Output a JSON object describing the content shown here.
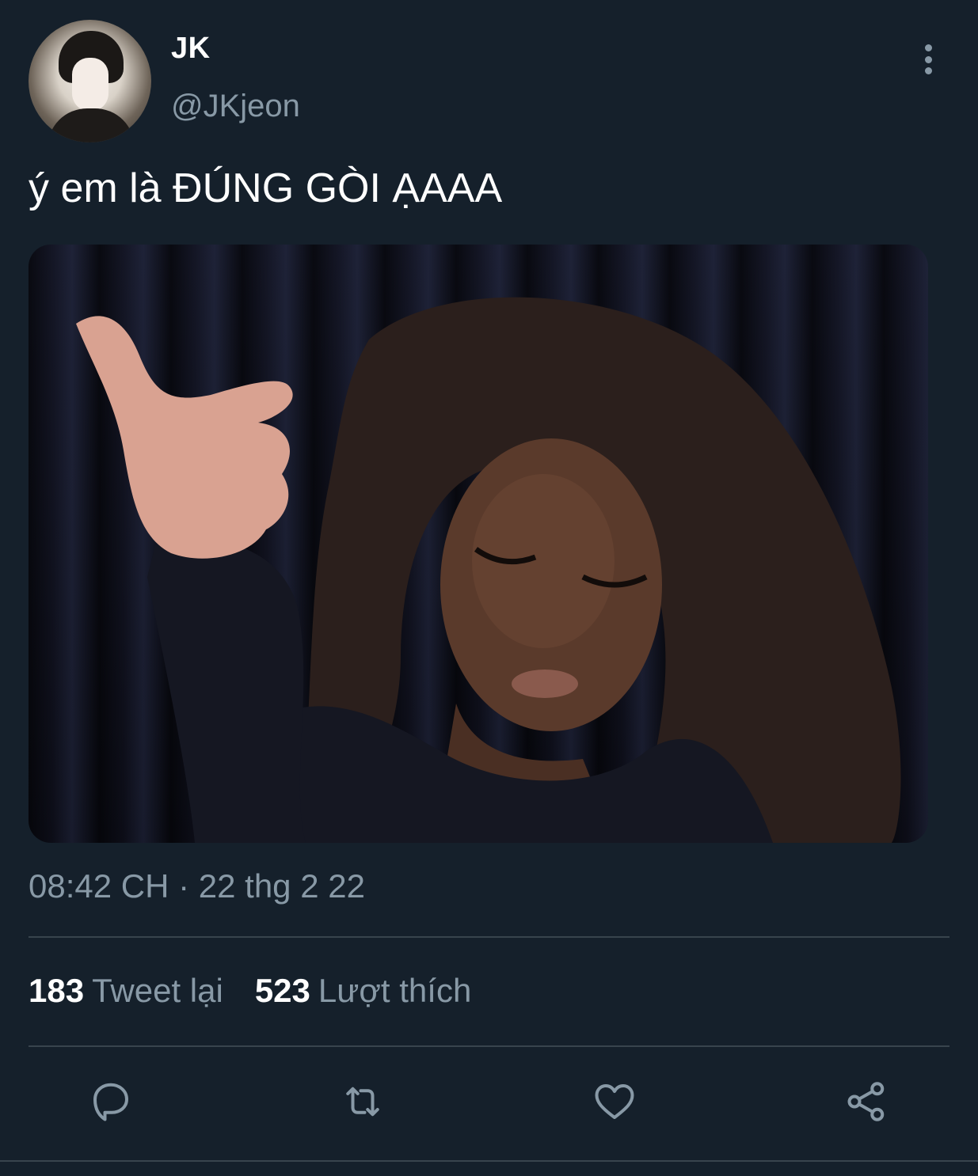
{
  "author": {
    "display_name": "JK",
    "handle": "@JKjeon"
  },
  "tweet": {
    "text": "ý em là ĐÚNG GÒI ẠAAA",
    "timestamp": "08:42 CH · 22 thg 2 22"
  },
  "stats": {
    "retweets_count": "183",
    "retweets_label": "Tweet lại",
    "likes_count": "523",
    "likes_label": "Lượt thích"
  },
  "actions": {
    "reply_icon": "reply-icon",
    "retweet_icon": "retweet-icon",
    "like_icon": "heart-icon",
    "share_icon": "share-icon"
  },
  "colors": {
    "background": "#15202b",
    "secondary_text": "#8899a6",
    "divider": "#38444d"
  }
}
